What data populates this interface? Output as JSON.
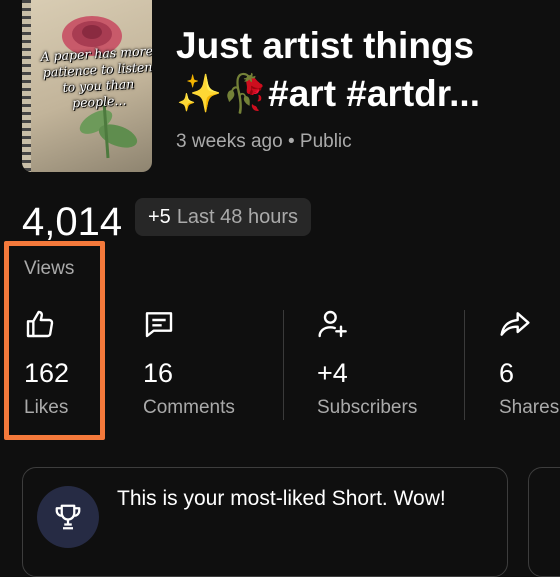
{
  "video": {
    "title_line1": "Just artist things",
    "title_line2": "✨🥀#art #artdr...",
    "meta": "3 weeks ago • Public",
    "thumbnail_text": "A paper has more patience to listen to you than people..."
  },
  "views": {
    "count": "4,014",
    "label": "Views",
    "delta": "+5",
    "delta_period": "Last 48 hours"
  },
  "stats": [
    {
      "icon": "thumb-up-icon",
      "value": "162",
      "label": "Likes"
    },
    {
      "icon": "comment-icon",
      "value": "16",
      "label": "Comments"
    },
    {
      "icon": "add-person-icon",
      "value": "+4",
      "label": "Subscribers"
    },
    {
      "icon": "share-icon",
      "value": "6",
      "label": "Shares"
    }
  ],
  "insight": {
    "icon": "trophy-icon",
    "text": "This is your most-liked Short. Wow!"
  },
  "colors": {
    "background": "#0f0f0f",
    "highlight": "#f4793b",
    "secondary_text": "#aaaaaa"
  }
}
